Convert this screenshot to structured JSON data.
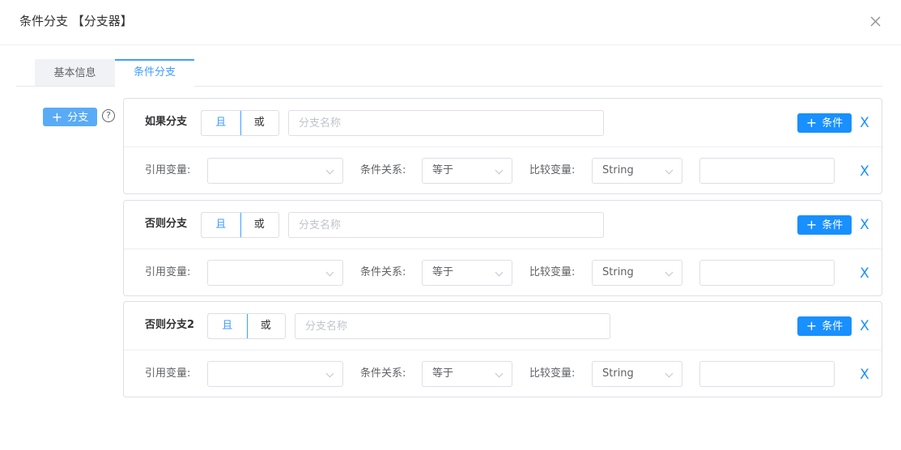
{
  "dialog": {
    "title": "条件分支 【分支器】"
  },
  "tabs": [
    {
      "label": "基本信息",
      "active": false
    },
    {
      "label": "条件分支",
      "active": true
    }
  ],
  "add_branch_label": "分支",
  "help_glyph": "?",
  "colors": {
    "primary": "#1890ff",
    "tab_active": "#409eff",
    "add_branch_bg": "#5aabf6"
  },
  "branches": [
    {
      "name_label": "如果分支",
      "logic": {
        "and": "且",
        "or": "或",
        "selected": "且"
      },
      "name_placeholder": "分支名称",
      "add_condition_label": "条件",
      "delete_glyph": "X",
      "condition": {
        "ref_var_label": "引用变量:",
        "ref_var_value": "",
        "relation_label": "条件关系:",
        "relation_value": "等于",
        "compare_label": "比较变量:",
        "compare_type": "String",
        "compare_value": "",
        "delete_glyph": "X"
      }
    },
    {
      "name_label": "否则分支",
      "logic": {
        "and": "且",
        "or": "或",
        "selected": "且"
      },
      "name_placeholder": "分支名称",
      "add_condition_label": "条件",
      "delete_glyph": "X",
      "condition": {
        "ref_var_label": "引用变量:",
        "ref_var_value": "",
        "relation_label": "条件关系:",
        "relation_value": "等于",
        "compare_label": "比较变量:",
        "compare_type": "String",
        "compare_value": "",
        "delete_glyph": "X"
      }
    },
    {
      "name_label": "否则分支2",
      "logic": {
        "and": "且",
        "or": "或",
        "selected": "且"
      },
      "name_placeholder": "分支名称",
      "add_condition_label": "条件",
      "delete_glyph": "X",
      "condition": {
        "ref_var_label": "引用变量:",
        "ref_var_value": "",
        "relation_label": "条件关系:",
        "relation_value": "等于",
        "compare_label": "比较变量:",
        "compare_type": "String",
        "compare_value": "",
        "delete_glyph": "X"
      }
    }
  ]
}
